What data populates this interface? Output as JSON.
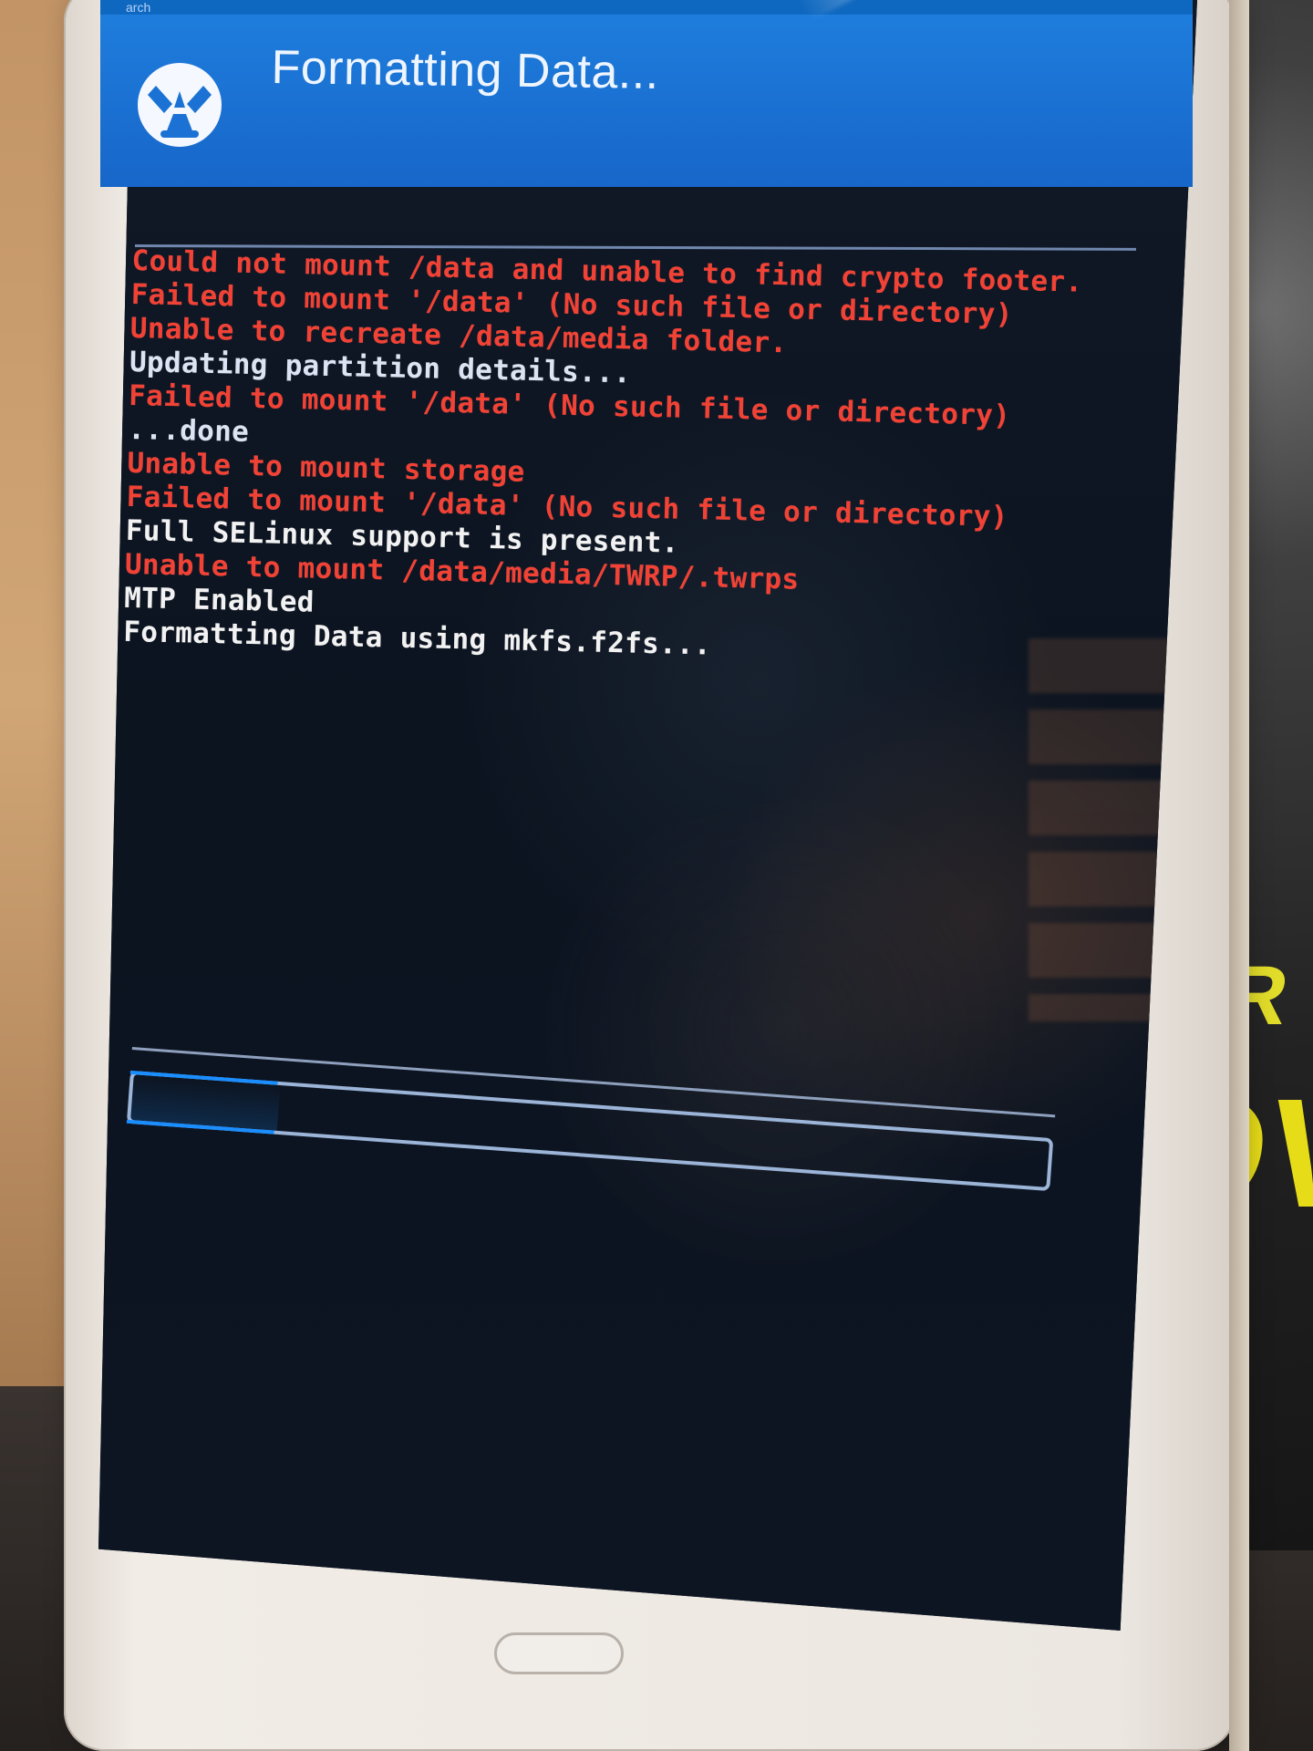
{
  "header": {
    "status_partial": "arch",
    "title": "Formatting Data...",
    "logo_icon": "twrp-logo-icon",
    "accent_color": "#1f7fde"
  },
  "console": {
    "lines": [
      "Could not mount /data and unable to find crypto footer.",
      "Failed to mount '/data' (No such file or directory)",
      "Unable to recreate /data/media folder.",
      "Updating partition details...",
      "Failed to mount '/data' (No such file or directory)",
      "...done",
      "Unable to mount storage",
      "Failed to mount '/data' (No such file or directory)",
      "Full SELinux support is present.",
      "Unable to mount /data/media/TWRP/.twrps",
      "MTP Enabled",
      "Formatting Data using mkfs.f2fs..."
    ],
    "colors": {
      "red": "#f14235",
      "white": "#f2f2f2",
      "light": "#dce3f2"
    }
  },
  "progress": {
    "value": 0.16,
    "bar_color": "#1a8eff"
  },
  "hardware": {
    "home_button_icon": "home-button-icon"
  },
  "background": {
    "fabric_text_1": "ER",
    "fabric_text_2": "OV"
  }
}
